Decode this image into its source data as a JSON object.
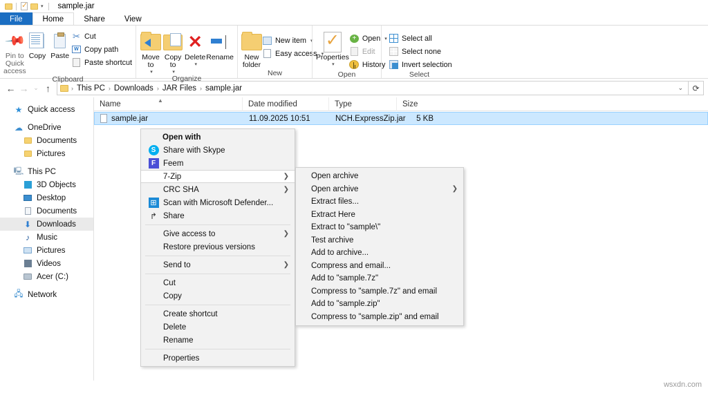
{
  "window": {
    "title": "sample.jar",
    "quick_access_icons": [
      "folder-icon",
      "properties-icon",
      "folder-icon",
      "chevron-down-icon"
    ]
  },
  "ribbon": {
    "tabs": [
      {
        "label": "File",
        "active": false,
        "is_file": true
      },
      {
        "label": "Home",
        "active": true,
        "is_file": false
      },
      {
        "label": "Share",
        "active": false,
        "is_file": false
      },
      {
        "label": "View",
        "active": false,
        "is_file": false
      }
    ],
    "groups": [
      {
        "label": "Clipboard",
        "big": [
          {
            "label": "Pin to Quick access",
            "icon": "pin-icon",
            "dim": true
          },
          {
            "label": "Copy",
            "icon": "copy-icon"
          },
          {
            "label": "Paste",
            "icon": "paste-icon"
          }
        ],
        "small": [
          {
            "label": "Cut",
            "icon": "scissors-icon"
          },
          {
            "label": "Copy path",
            "icon": "copy-path-icon"
          },
          {
            "label": "Paste shortcut",
            "icon": "paste-shortcut-icon"
          }
        ]
      },
      {
        "label": "Organize",
        "big": [
          {
            "label": "Move to",
            "icon": "move-to-folder-icon",
            "caret": true
          },
          {
            "label": "Copy to",
            "icon": "copy-to-folder-icon",
            "caret": true
          },
          {
            "label": "Delete",
            "icon": "delete-x-icon",
            "caret": true
          },
          {
            "label": "Rename",
            "icon": "rename-icon"
          }
        ],
        "small": []
      },
      {
        "label": "New",
        "big": [
          {
            "label": "New folder",
            "icon": "new-folder-icon"
          }
        ],
        "small": [
          {
            "label": "New item",
            "icon": "new-item-icon",
            "caret": true
          },
          {
            "label": "Easy access",
            "icon": "easy-access-icon",
            "caret": true
          }
        ]
      },
      {
        "label": "Open",
        "big": [
          {
            "label": "Properties",
            "icon": "properties-icon",
            "caret": true
          }
        ],
        "small": [
          {
            "label": "Open",
            "icon": "open-icon",
            "caret": true
          },
          {
            "label": "Edit",
            "icon": "edit-icon",
            "disabled": true
          },
          {
            "label": "History",
            "icon": "history-icon"
          }
        ]
      },
      {
        "label": "Select",
        "big": [],
        "small": [
          {
            "label": "Select all",
            "icon": "select-all-icon"
          },
          {
            "label": "Select none",
            "icon": "select-none-icon"
          },
          {
            "label": "Invert selection",
            "icon": "invert-selection-icon"
          }
        ]
      }
    ]
  },
  "address_bar": {
    "back_icon": "arrow-left-icon",
    "forward_icon": "arrow-right-icon",
    "recent_icon": "chevron-down-icon",
    "up_icon": "arrow-up-icon",
    "breadcrumbs": [
      "This PC",
      "Downloads",
      "JAR Files",
      "sample.jar"
    ],
    "dropdown_icon": "chevron-down-icon",
    "refresh_icon": "refresh-icon"
  },
  "sidebar": {
    "items": [
      {
        "label": "Quick access",
        "icon": "star-icon",
        "indent": false,
        "selected": false
      },
      {
        "label": "OneDrive",
        "icon": "cloud-icon",
        "indent": false,
        "selected": false,
        "gap_before": true
      },
      {
        "label": "Documents",
        "icon": "folder-icon",
        "indent": true,
        "selected": false
      },
      {
        "label": "Pictures",
        "icon": "folder-icon",
        "indent": true,
        "selected": false
      },
      {
        "label": "This PC",
        "icon": "computer-icon",
        "indent": false,
        "selected": false,
        "gap_before": true
      },
      {
        "label": "3D Objects",
        "icon": "3d-objects-icon",
        "indent": true,
        "selected": false
      },
      {
        "label": "Desktop",
        "icon": "desktop-icon",
        "indent": true,
        "selected": false
      },
      {
        "label": "Documents",
        "icon": "documents-icon",
        "indent": true,
        "selected": false
      },
      {
        "label": "Downloads",
        "icon": "downloads-icon",
        "indent": true,
        "selected": true
      },
      {
        "label": "Music",
        "icon": "music-icon",
        "indent": true,
        "selected": false
      },
      {
        "label": "Pictures",
        "icon": "pictures-icon",
        "indent": true,
        "selected": false
      },
      {
        "label": "Videos",
        "icon": "videos-icon",
        "indent": true,
        "selected": false
      },
      {
        "label": "Acer (C:)",
        "icon": "drive-icon",
        "indent": true,
        "selected": false
      },
      {
        "label": "Network",
        "icon": "network-icon",
        "indent": false,
        "selected": false,
        "gap_before": true
      }
    ]
  },
  "file_list": {
    "columns": [
      "Name",
      "Date modified",
      "Type",
      "Size"
    ],
    "sort_indicator": "ascending-sort-icon",
    "rows": [
      {
        "name": "sample.jar",
        "date_modified": "11.09.2025 10:51",
        "type": "NCH.ExpressZip.jar",
        "size": "5 KB",
        "icon": "jar-file-icon",
        "selected": true
      }
    ]
  },
  "context_menu": {
    "items": [
      {
        "label": "Open with",
        "icon": null,
        "bold": true,
        "arrow": false
      },
      {
        "label": "Share with Skype",
        "icon": "skype-icon",
        "arrow": false
      },
      {
        "label": "Feem",
        "icon": "feem-icon",
        "arrow": false
      },
      {
        "label": "7-Zip",
        "icon": null,
        "arrow": true,
        "hover": true
      },
      {
        "label": "CRC SHA",
        "icon": null,
        "arrow": true
      },
      {
        "label": "Scan with Microsoft Defender...",
        "icon": "defender-icon",
        "arrow": false
      },
      {
        "label": "Share",
        "icon": "share-icon",
        "arrow": false
      },
      {
        "separator": true
      },
      {
        "label": "Give access to",
        "icon": null,
        "arrow": true
      },
      {
        "label": "Restore previous versions",
        "icon": null,
        "arrow": false
      },
      {
        "separator": true
      },
      {
        "label": "Send to",
        "icon": null,
        "arrow": true
      },
      {
        "separator": true
      },
      {
        "label": "Cut",
        "icon": null,
        "arrow": false
      },
      {
        "label": "Copy",
        "icon": null,
        "arrow": false
      },
      {
        "separator": true
      },
      {
        "label": "Create shortcut",
        "icon": null,
        "arrow": false
      },
      {
        "label": "Delete",
        "icon": null,
        "arrow": false
      },
      {
        "label": "Rename",
        "icon": null,
        "arrow": false
      },
      {
        "separator": true
      },
      {
        "label": "Properties",
        "icon": null,
        "arrow": false
      }
    ]
  },
  "submenu": {
    "parent": "7-Zip",
    "items": [
      {
        "label": "Open archive",
        "arrow": false
      },
      {
        "label": "Open archive",
        "arrow": true
      },
      {
        "label": "Extract files...",
        "arrow": false
      },
      {
        "label": "Extract Here",
        "arrow": false
      },
      {
        "label": "Extract to \"sample\\\"",
        "arrow": false
      },
      {
        "label": "Test archive",
        "arrow": false
      },
      {
        "label": "Add to archive...",
        "arrow": false
      },
      {
        "label": "Compress and email...",
        "arrow": false
      },
      {
        "label": "Add to \"sample.7z\"",
        "arrow": false
      },
      {
        "label": "Compress to \"sample.7z\" and email",
        "arrow": false
      },
      {
        "label": "Add to \"sample.zip\"",
        "arrow": false
      },
      {
        "label": "Compress to \"sample.zip\" and email",
        "arrow": false
      }
    ]
  },
  "watermark": {
    "text": "wsxdn.com"
  },
  "colors": {
    "file_tab": "#1b6ec2",
    "selection": "#cce8ff",
    "selection_border": "#99d1ff",
    "sidebar_selected": "#eaeaea"
  }
}
